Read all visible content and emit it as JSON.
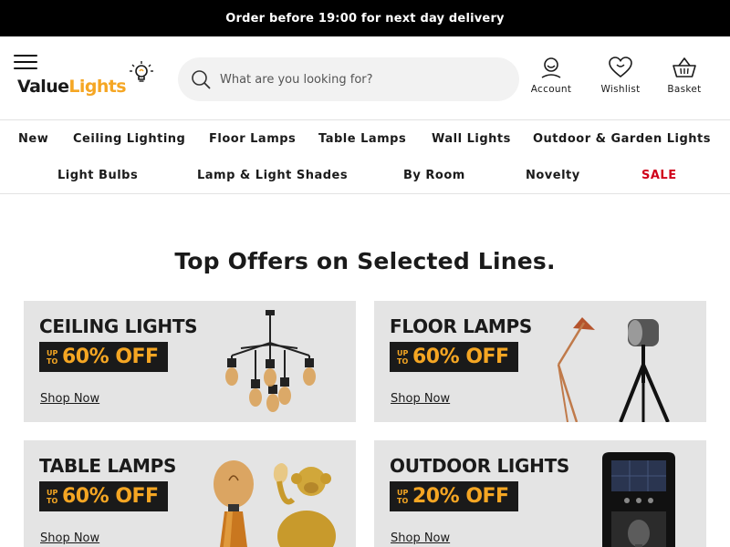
{
  "announcement": {
    "text": "Order before 19:00 for next day delivery"
  },
  "header": {
    "logo": {
      "part1": "Value",
      "part2": "Lights"
    },
    "search": {
      "placeholder": "What are you looking for?",
      "value": ""
    },
    "account_label": "Account",
    "wishlist_label": "Wishlist",
    "basket_label": "Basket"
  },
  "nav": {
    "row1": [
      "New",
      "Ceiling Lighting",
      "Floor Lamps",
      "Table Lamps",
      "Wall Lights",
      "Outdoor & Garden Lights"
    ],
    "row2": [
      "Light Bulbs",
      "Lamp & Light Shades",
      "By Room",
      "Novelty",
      "SALE"
    ]
  },
  "offers": {
    "title": "Top Offers on Selected Lines.",
    "cards": [
      {
        "title": "CEILING LIGHTS",
        "upto": "UP TO",
        "discount": "60% OFF",
        "cta": "Shop Now"
      },
      {
        "title": "FLOOR LAMPS",
        "upto": "UP TO",
        "discount": "60% OFF",
        "cta": "Shop Now"
      },
      {
        "title": "TABLE LAMPS",
        "upto": "UP TO",
        "discount": "60% OFF",
        "cta": "Shop Now"
      },
      {
        "title": "OUTDOOR LIGHTS",
        "upto": "UP TO",
        "discount": "20% OFF",
        "cta": "Shop Now"
      }
    ]
  },
  "colors": {
    "accent": "#f5a623",
    "sale": "#d0021b",
    "topbar": "#000000",
    "card_bg": "#e4e4e4"
  },
  "icons": [
    "menu-icon",
    "bulb-icon",
    "search-icon",
    "account-icon",
    "wishlist-heart-icon",
    "basket-icon"
  ]
}
